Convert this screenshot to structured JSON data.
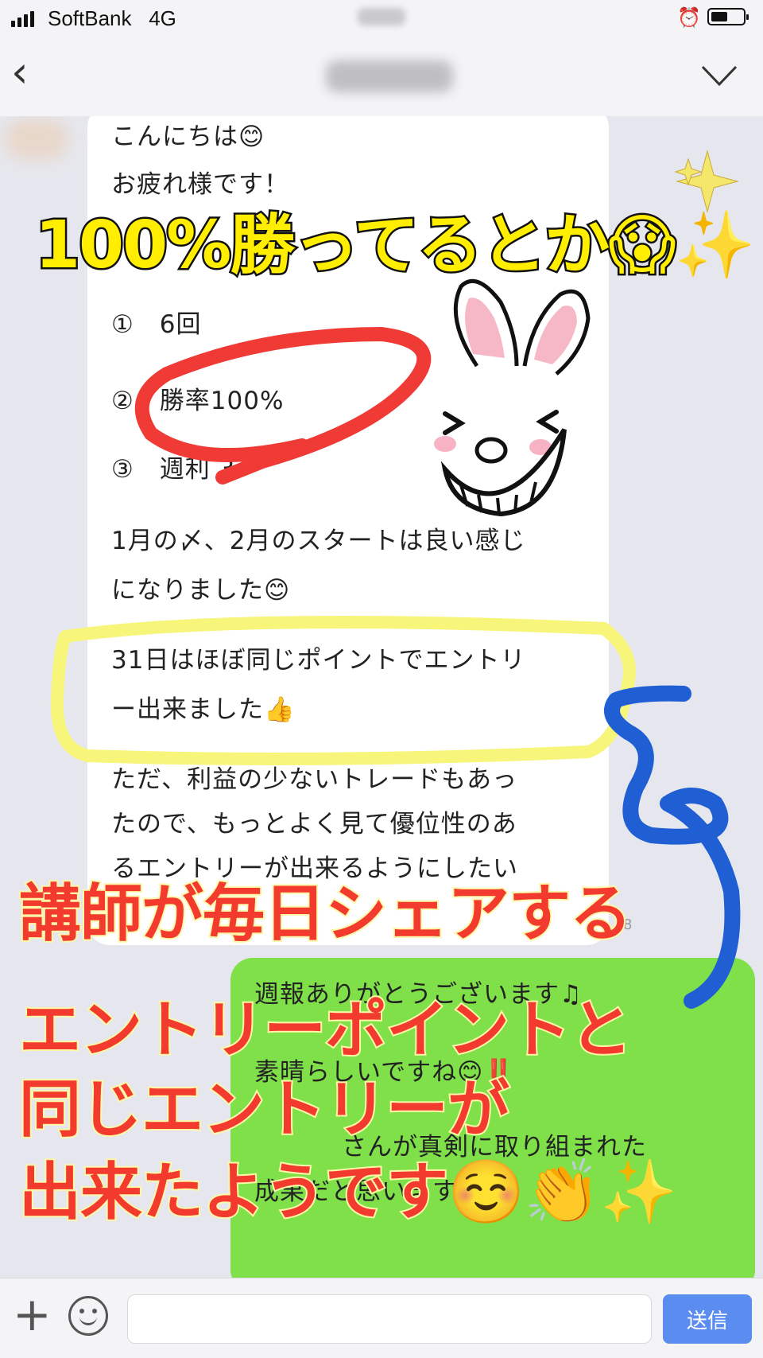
{
  "status_bar": {
    "carrier": "SoftBank",
    "network": "4G",
    "alarm_icon": "alarm-icon",
    "battery_icon": "battery-icon"
  },
  "nav": {
    "back_icon": "chevron-left-icon",
    "menu_icon": "chevron-down-icon"
  },
  "incoming_message": {
    "lines": [
      "こんにちは😊",
      "お疲れ様です！",
      "①　6回",
      "②　勝率100%",
      "③　週利 3",
      "1月の〆、2月のスタートは良い感じ",
      "になりました😊",
      "31日はほぼ同じポイントでエントリ",
      "ー出来ました👍",
      "ただ、利益の少ないトレードもあっ",
      "たので、もっとよく見て優位性のあ",
      "るエントリーが出来るようにしたい"
    ],
    "time": "8"
  },
  "outgoing_message": {
    "lines": [
      "週報ありがとうございます♫",
      "素晴らしいですね😊‼️",
      "さんが真剣に取り組まれた",
      "成果だと思います✨"
    ]
  },
  "annotations": {
    "top_caption": "100%勝ってるとか😱✨",
    "red_captions": [
      "講師が毎日シェアする",
      "エントリーポイントと",
      "同じエントリーが",
      "出来たようです☺️👏✨"
    ],
    "sticker": "rabbit-sticker"
  },
  "input_bar": {
    "plus_icon": "plus-icon",
    "emoji_icon": "emoji-icon",
    "placeholder": "",
    "send_label": "送信"
  },
  "colors": {
    "outgoing_bubble": "#7fe04a",
    "send_button": "#5b8cf0",
    "caption_yellow": "#ffee00",
    "caption_red": "#f23b2e"
  }
}
